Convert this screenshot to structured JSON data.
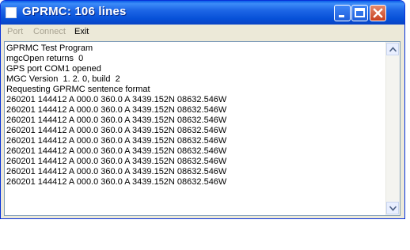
{
  "window": {
    "title": "GPRMC:  106 lines",
    "colors": {
      "titlebar": "#0751d8",
      "close_button": "#c8401f",
      "frame": "#ece9d8"
    }
  },
  "titlebar_buttons": [
    {
      "icon": "minimize-icon"
    },
    {
      "icon": "maximize-icon"
    },
    {
      "icon": "close-icon"
    }
  ],
  "menu": {
    "items": [
      {
        "label": "Port",
        "enabled": false
      },
      {
        "label": "Connect",
        "enabled": false
      },
      {
        "label": "Exit",
        "enabled": true
      }
    ]
  },
  "output": {
    "lines": [
      "GPRMC Test Program",
      "mgcOpen returns  0",
      "GPS port COM1 opened",
      "MGC Version  1. 2. 0, build  2",
      "Requesting GPRMC sentence format",
      "260201 144412 A 000.0 360.0 A 3439.152N 08632.546W",
      "260201 144412 A 000.0 360.0 A 3439.152N 08632.546W",
      "260201 144412 A 000.0 360.0 A 3439.152N 08632.546W",
      "260201 144412 A 000.0 360.0 A 3439.152N 08632.546W",
      "260201 144412 A 000.0 360.0 A 3439.152N 08632.546W",
      "260201 144412 A 000.0 360.0 A 3439.152N 08632.546W",
      "260201 144412 A 000.0 360.0 A 3439.152N 08632.546W",
      "260201 144412 A 000.0 360.0 A 3439.152N 08632.546W",
      "260201 144412 A 000.0 360.0 A 3439.152N 08632.546W"
    ]
  },
  "scrollbar": {
    "up_icon": "arrow-up-icon",
    "down_icon": "arrow-down-icon"
  }
}
